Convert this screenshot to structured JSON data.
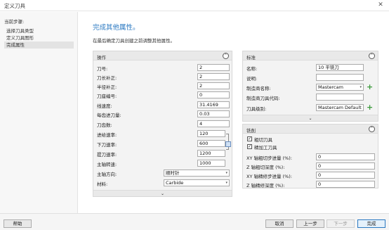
{
  "window": {
    "title": "定义刀具",
    "close_label": "✕"
  },
  "left": {
    "steps_title": "当前步骤:",
    "steps": [
      {
        "label": "选择刀具类型",
        "active": false
      },
      {
        "label": "定义刀具图形",
        "active": false
      },
      {
        "label": "完成属性",
        "active": true
      }
    ]
  },
  "main": {
    "title": "完成其他属性。",
    "subtitle": "在最后确定刀具创建之前调整其他属性。"
  },
  "operation": {
    "title": "操作",
    "collapse_icon": "⌃",
    "expand_icon": "⌄",
    "fields": [
      {
        "label": "刀号:",
        "value": "2"
      },
      {
        "label": "刀长补正:",
        "value": "2"
      },
      {
        "label": "半径补正:",
        "value": "2"
      },
      {
        "label": "刀座编号:",
        "value": "0"
      },
      {
        "label": "线速度:",
        "value": "31.4169"
      },
      {
        "label": "每齿进刀量:",
        "value": "0.03"
      },
      {
        "label": "刀齿数:",
        "value": "4"
      },
      {
        "label": "进给速率:",
        "value": "120"
      },
      {
        "label": "下刀速率:",
        "value": "600"
      },
      {
        "label": "提刀速率:",
        "value": "1200"
      },
      {
        "label": "主轴转速:",
        "value": "1000"
      }
    ],
    "spindle_direction": {
      "label": "主轴方向:",
      "value": "顺时针"
    },
    "material": {
      "label": "材料:",
      "value": "Carbide"
    }
  },
  "standard": {
    "title": "标准",
    "name": {
      "label": "名称:",
      "value": "10 平铣刀"
    },
    "description": {
      "label": "说明:",
      "value": ""
    },
    "manufacturer": {
      "label": "制造商名称:",
      "value": "Mastercam"
    },
    "manufacturer_code": {
      "label": "制造商刀具代码:",
      "value": ""
    },
    "tool_level": {
      "label": "刀具级别:",
      "value": "Mastercam Default"
    }
  },
  "milling": {
    "title": "铣削",
    "rough_tool": {
      "label": "粗切刀具",
      "checked": true
    },
    "finish_tool": {
      "label": "精加工刀具",
      "checked": true
    },
    "fields": [
      {
        "label": "XY 轴粗切步进量 (%):",
        "value": "0"
      },
      {
        "label": "Z 轴粗切深度 (%):",
        "value": "0"
      },
      {
        "label": "XY 轴精修步进量 (%):",
        "value": "0"
      },
      {
        "label": "Z 轴精修深度 (%):",
        "value": "0"
      }
    ]
  },
  "buttons": {
    "help": "帮助",
    "cancel": "取消",
    "back": "上一步",
    "next": "下一步",
    "finish": "完成"
  },
  "colors": {
    "accent": "#2b79c2",
    "add_green": "#3c9a3c"
  }
}
